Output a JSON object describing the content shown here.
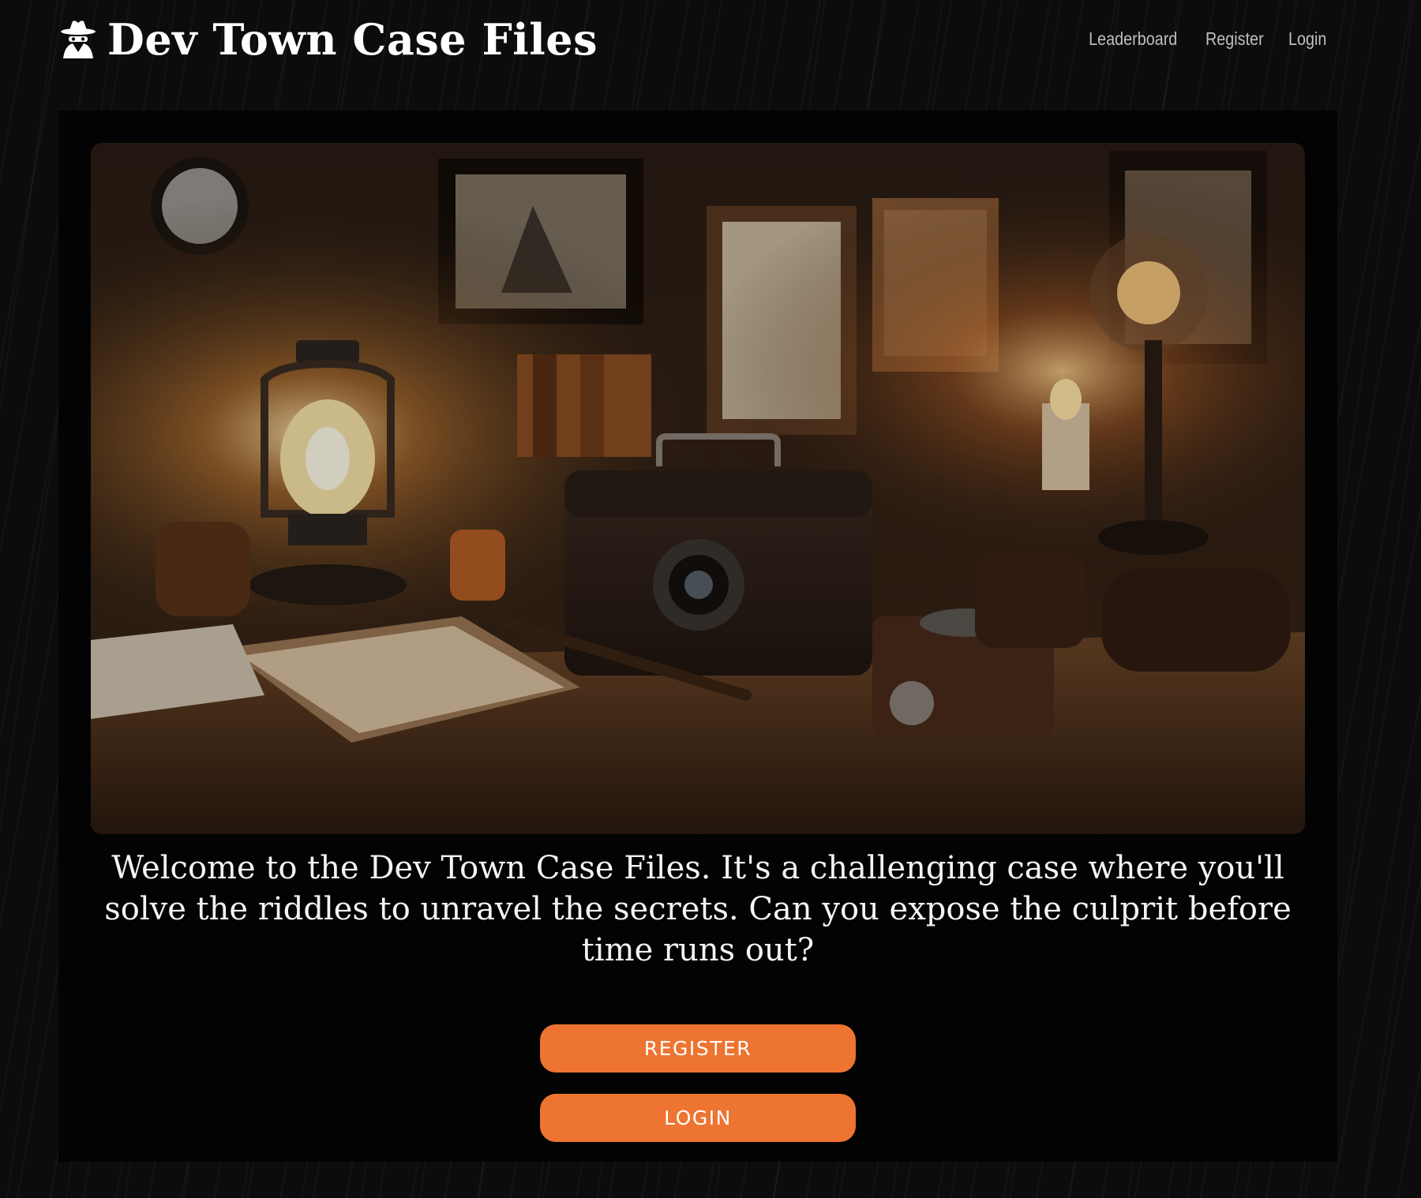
{
  "app": {
    "title": "Dev Town Case Files",
    "logo_icon": "detective-icon"
  },
  "nav": {
    "items": [
      {
        "label": "Leaderboard"
      },
      {
        "label": "Register"
      },
      {
        "label": "Login"
      }
    ]
  },
  "hero": {
    "image_subject": "vintage detective desk with lantern, camera, books and picture frames"
  },
  "main": {
    "intro_text": "Welcome to the Dev Town Case Files. It's a challenging case where you'll solve the riddles to unravel the secrets. Can you expose the culprit before time runs out?",
    "register_label": "REGISTER",
    "login_label": "LOGIN"
  },
  "colors": {
    "accent": "#ed7431",
    "background": "#0c0c0e",
    "panel": "#030303"
  }
}
